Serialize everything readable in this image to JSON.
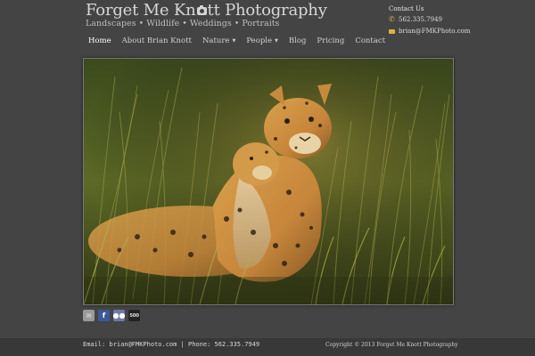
{
  "header": {
    "title_before": "Forget Me Kn",
    "title_icon": "camera-icon",
    "title_after": "tt Photography",
    "tagline": "Landscapes • Wildlife • Weddings • Portraits"
  },
  "contact": {
    "heading": "Contact Us",
    "phone_icon": "phone-icon",
    "phone": "562.335.7949",
    "email_icon": "envelope-icon",
    "email": "brian@FMKPhoto.com"
  },
  "nav": {
    "items": [
      {
        "label": "Home",
        "active": true
      },
      {
        "label": "About Brian Knott"
      },
      {
        "label": "Nature",
        "dropdown": "▼"
      },
      {
        "label": "People",
        "dropdown": "▼"
      },
      {
        "label": "Blog"
      },
      {
        "label": "Pricing"
      },
      {
        "label": "Contact"
      }
    ]
  },
  "social": {
    "email_glyph": "✉",
    "facebook_glyph": "f",
    "flickr_glyph": "●●",
    "fivehundred_glyph": "500"
  },
  "footer": {
    "contact_line": "Email: brian@FMKPhoto.com | Phone: 562.335.7949",
    "copyright": "Copyright © 2013 Forget Me Knott Photography"
  },
  "colors": {
    "background": "#444444",
    "accent": "#d9b43c",
    "footer_bg": "#383838"
  }
}
